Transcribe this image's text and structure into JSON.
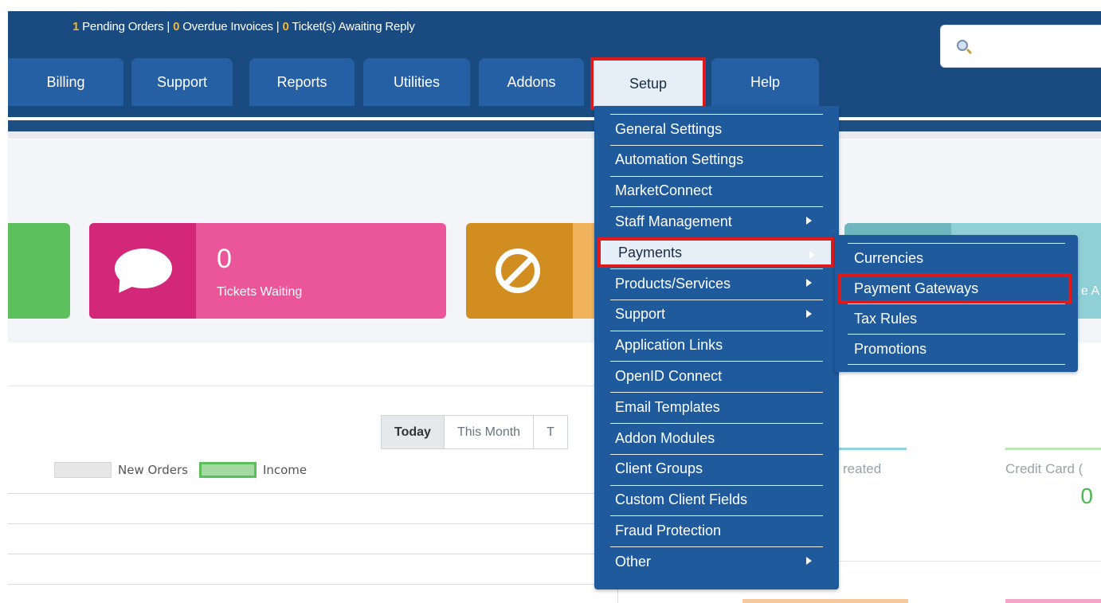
{
  "notices": {
    "pending_orders_count": "1",
    "pending_orders_label": "Pending Orders",
    "overdue_count": "0",
    "overdue_label": "Overdue Invoices",
    "tickets_count": "0",
    "tickets_label": "Ticket(s) Awaiting Reply",
    "separator": "|"
  },
  "search": {
    "placeholder": ""
  },
  "tabs": [
    {
      "label": "Billing"
    },
    {
      "label": "Support"
    },
    {
      "label": "Reports"
    },
    {
      "label": "Utilities"
    },
    {
      "label": "Addons"
    },
    {
      "label": "Setup"
    },
    {
      "label": "Help"
    }
  ],
  "cards": {
    "tickets": {
      "count": "0",
      "label": "Tickets Waiting"
    },
    "teal_tail": "e A"
  },
  "chart": {
    "ranges": [
      "Today",
      "This Month",
      "T"
    ],
    "legend": {
      "new_orders": "New Orders",
      "income": "Income"
    }
  },
  "stats": {
    "created_label": "reated",
    "credit_label": "Credit Card (",
    "credit_value": "0"
  },
  "setup_menu": [
    {
      "label": "General Settings",
      "submenu": false
    },
    {
      "label": "Automation Settings",
      "submenu": false
    },
    {
      "label": "MarketConnect",
      "submenu": false
    },
    {
      "label": "Staff Management",
      "submenu": true
    },
    {
      "label": "Payments",
      "submenu": true
    },
    {
      "label": "Products/Services",
      "submenu": true
    },
    {
      "label": "Support",
      "submenu": true
    },
    {
      "label": "Application Links",
      "submenu": false
    },
    {
      "label": "OpenID Connect",
      "submenu": false
    },
    {
      "label": "Email Templates",
      "submenu": false
    },
    {
      "label": "Addon Modules",
      "submenu": false
    },
    {
      "label": "Client Groups",
      "submenu": false
    },
    {
      "label": "Custom Client Fields",
      "submenu": false
    },
    {
      "label": "Fraud Protection",
      "submenu": false
    },
    {
      "label": "Other",
      "submenu": true
    }
  ],
  "payments_submenu": [
    {
      "label": "Currencies"
    },
    {
      "label": "Payment Gateways"
    },
    {
      "label": "Tax Rules"
    },
    {
      "label": "Promotions"
    }
  ],
  "colors": {
    "header": "#1a4b80",
    "tab": "#2560a4",
    "menu": "#1e5a9c",
    "highlight": "#e0191c",
    "notice_number": "#f2b632"
  }
}
